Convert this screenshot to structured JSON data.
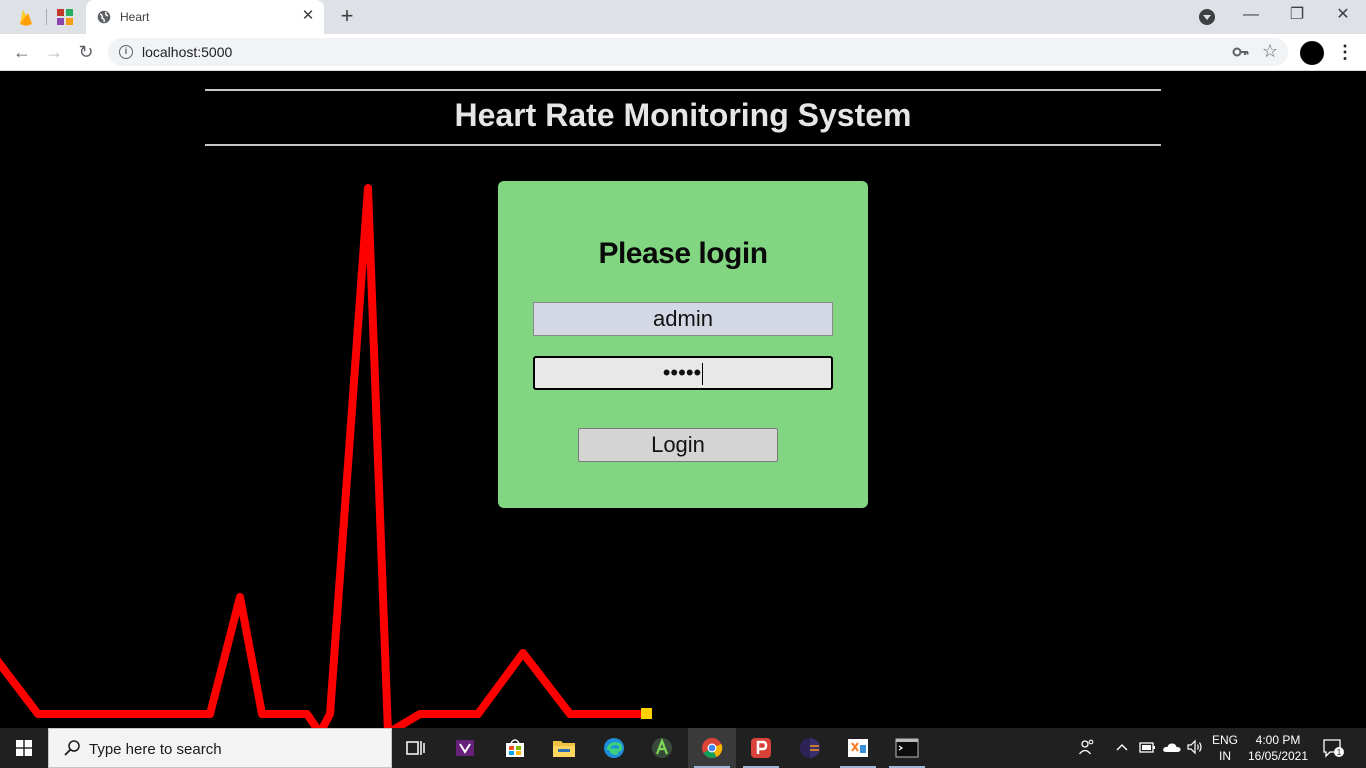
{
  "browser": {
    "tab_title": "Heart",
    "tab_close": "✕",
    "new_tab": "+",
    "url": "localhost:5000",
    "window_controls": {
      "minimize": "—",
      "maximize": "❐",
      "close": "✕"
    },
    "nav": {
      "back": "←",
      "forward": "→",
      "reload": "↻",
      "menu": "⋮",
      "star": "☆",
      "info": "i"
    }
  },
  "page": {
    "site_title": "Heart Rate Monitoring System",
    "login": {
      "heading": "Please login",
      "username_value": "admin",
      "password_mask": "•••••",
      "button_label": "Login"
    },
    "ecg_color": "#ff0000",
    "login_box_color": "#82d682"
  },
  "taskbar": {
    "search_placeholder": "Type here to search",
    "lang_line1": "ENG",
    "lang_line2": "IN",
    "time": "4:00 PM",
    "date": "16/05/2021"
  }
}
